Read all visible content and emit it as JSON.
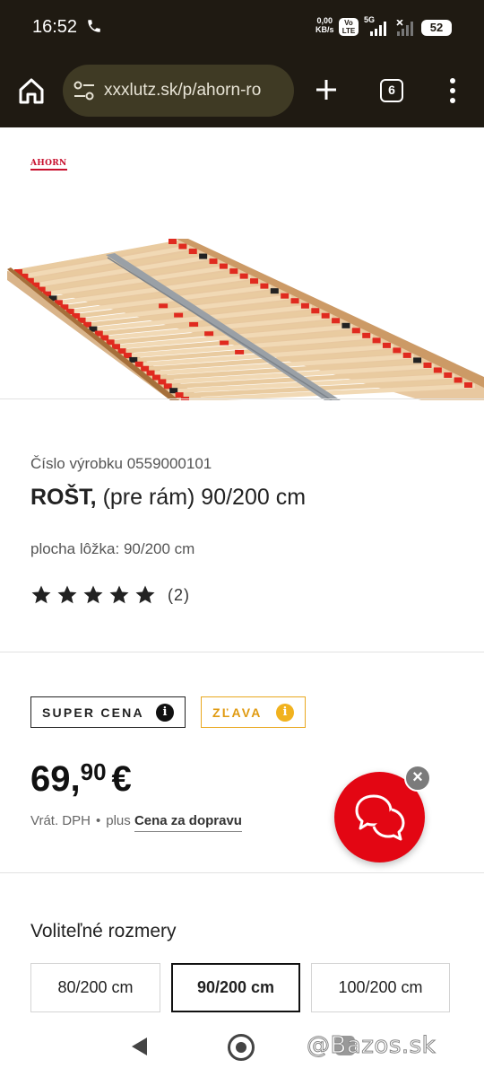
{
  "status_bar": {
    "time": "16:52",
    "net_speed_value": "0,00",
    "net_speed_unit": "KB/s",
    "volte_top": "Vo",
    "volte_bottom": "LTE",
    "network_type": "5G",
    "battery": "52"
  },
  "browser": {
    "url": "xxxlutz.sk/p/ahorn-ro",
    "tab_count": "6"
  },
  "product": {
    "brand_logo_text": "AHORN",
    "sku_label": "Číslo výrobku 0559000101",
    "title_bold": "ROŠT,",
    "title_rest": " (pre rám) 90/200 cm",
    "bed_surface": "plocha lôžka: 90/200 cm",
    "rating_stars": 5,
    "rating_count": "(2)"
  },
  "badges": {
    "super": "SUPER CENA",
    "discount": "ZĽAVA",
    "info_glyph": "i"
  },
  "price": {
    "main": "69,",
    "cents": "90",
    "currency": "€",
    "vat": "Vrát. DPH",
    "separator": "•",
    "plus": "plus",
    "shipping_link": "Cena za dopravu"
  },
  "chat": {
    "close_glyph": "×"
  },
  "sizes": {
    "heading": "Voliteľné rozmery",
    "options": [
      "80/200 cm",
      "90/200 cm",
      "100/200 cm"
    ],
    "selected_index": 1
  },
  "watermark": "@Bazos.sk",
  "colors": {
    "topbar": "#1f1a12",
    "accent_red": "#e30613",
    "discount_orange": "#e9a81f"
  }
}
